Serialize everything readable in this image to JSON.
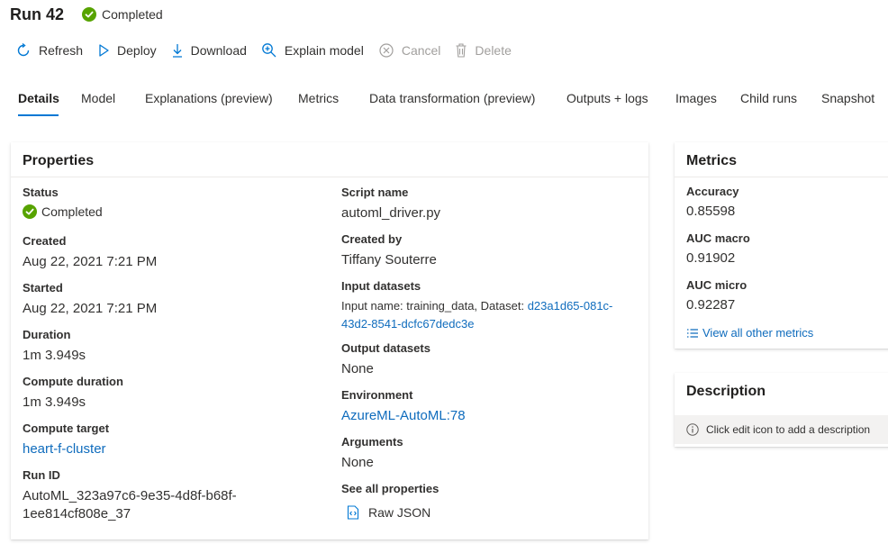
{
  "header": {
    "title": "Run 42",
    "status": "Completed"
  },
  "toolbar": {
    "refresh": "Refresh",
    "deploy": "Deploy",
    "download": "Download",
    "explain": "Explain model",
    "cancel": "Cancel",
    "delete": "Delete"
  },
  "tabs": [
    "Details",
    "Model",
    "Explanations (preview)",
    "Metrics",
    "Data transformation (preview)",
    "Outputs + logs",
    "Images",
    "Child runs",
    "Snapshot"
  ],
  "properties": {
    "title": "Properties",
    "status_label": "Status",
    "status_value": "Completed",
    "created_label": "Created",
    "created_value": "Aug 22, 2021 7:21 PM",
    "started_label": "Started",
    "started_value": "Aug 22, 2021 7:21 PM",
    "duration_label": "Duration",
    "duration_value": "1m 3.949s",
    "compute_duration_label": "Compute duration",
    "compute_duration_value": "1m 3.949s",
    "compute_target_label": "Compute target",
    "compute_target_value": "heart-f-cluster",
    "run_id_label": "Run ID",
    "run_id_line1": "AutoML_323a97c6-9e35-4d8f-b68f-",
    "run_id_line2": "1ee814cf808e_37",
    "script_name_label": "Script name",
    "script_name_value": "automl_driver.py",
    "created_by_label": "Created by",
    "created_by_value": "Tiffany Souterre",
    "input_datasets_label": "Input datasets",
    "input_datasets_prefix": "Input name: training_data, Dataset: ",
    "input_datasets_link1": "d23a1d65-081c-",
    "input_datasets_link2": "43d2-8541-dcfc67dedc3e",
    "output_datasets_label": "Output datasets",
    "output_datasets_value": "None",
    "environment_label": "Environment",
    "environment_value": "AzureML-AutoML:78",
    "arguments_label": "Arguments",
    "arguments_value": "None",
    "see_all_label": "See all properties",
    "raw_json": "Raw JSON"
  },
  "metrics": {
    "title": "Metrics",
    "items": [
      {
        "label": "Accuracy",
        "value": "0.85598"
      },
      {
        "label": "AUC macro",
        "value": "0.91902"
      },
      {
        "label": "AUC micro",
        "value": "0.92287"
      }
    ],
    "view_all": "View all other metrics"
  },
  "description": {
    "title": "Description",
    "placeholder": "Click edit icon to add a description"
  },
  "colors": {
    "accent": "#0078d4",
    "link": "#0f6cbd",
    "success": "#57a300"
  }
}
